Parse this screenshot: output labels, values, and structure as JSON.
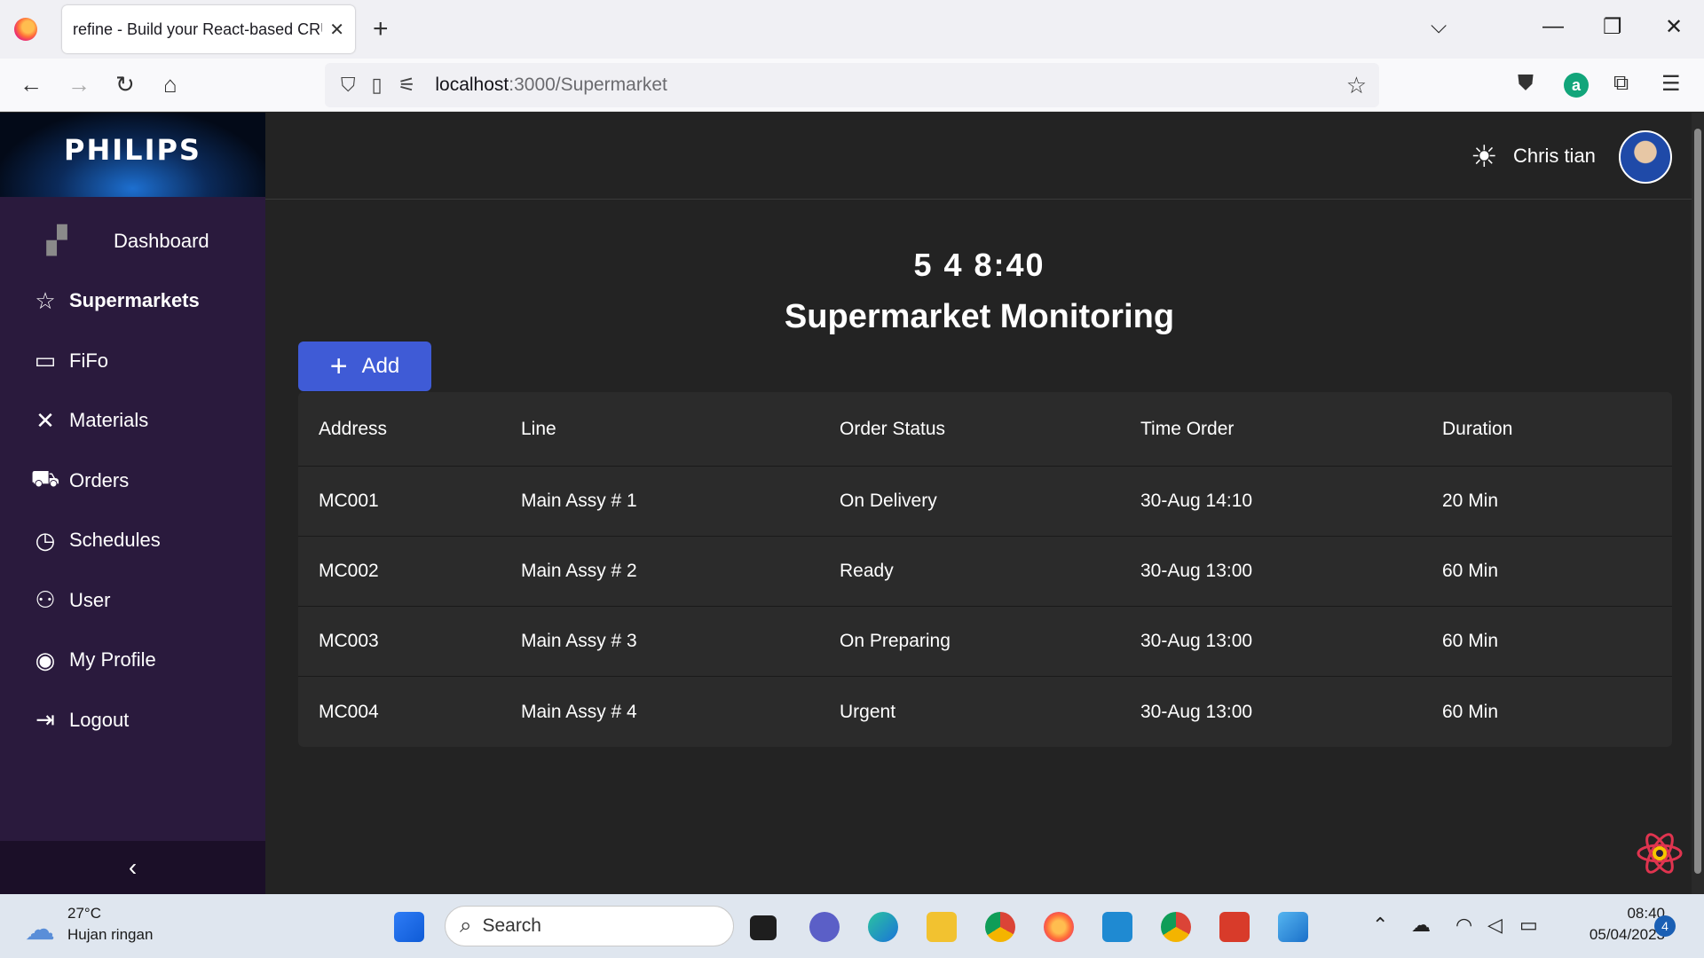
{
  "browser": {
    "tab_title": "refine - Build your React-based CRUD",
    "url_host": "localhost",
    "url_path": ":3000/Supermarket"
  },
  "sidebar": {
    "logo": "PHILIPS",
    "items": [
      {
        "label": "Dashboard",
        "icon": "dashboard-icon"
      },
      {
        "label": "Supermarkets",
        "icon": "star-icon",
        "active": true
      },
      {
        "label": "FiFo",
        "icon": "chat-icon"
      },
      {
        "label": "Materials",
        "icon": "tools-icon"
      },
      {
        "label": "Orders",
        "icon": "cart-icon"
      },
      {
        "label": "Schedules",
        "icon": "clock-icon"
      },
      {
        "label": "User",
        "icon": "users-icon"
      },
      {
        "label": "My Profile",
        "icon": "profile-icon"
      },
      {
        "label": "Logout",
        "icon": "logout-icon"
      }
    ]
  },
  "header": {
    "username": "Chris tian"
  },
  "main": {
    "clock": "5 4 8:40",
    "title": "Supermarket Monitoring",
    "add_label": "Add",
    "table": {
      "headers": [
        "Address",
        "Line",
        "Order Status",
        "Time Order",
        "Duration"
      ],
      "rows": [
        [
          "MC001",
          "Main Assy # 1",
          "On Delivery",
          "30-Aug 14:10",
          "20 Min"
        ],
        [
          "MC002",
          "Main Assy # 2",
          "Ready",
          "30-Aug 13:00",
          "60 Min"
        ],
        [
          "MC003",
          "Main Assy # 3",
          "On Preparing",
          "30-Aug 13:00",
          "60 Min"
        ],
        [
          "MC004",
          "Main Assy # 4",
          "Urgent",
          "30-Aug 13:00",
          "60 Min"
        ]
      ]
    }
  },
  "taskbar": {
    "weather_temp": "27°C",
    "weather_desc": "Hujan ringan",
    "search_placeholder": "Search",
    "time": "08:40",
    "date": "05/04/2023",
    "notifications": "4"
  },
  "colors": {
    "sidebar_bg": "#2a1a3d",
    "main_bg": "#232323",
    "accent": "#3f5bd6"
  }
}
